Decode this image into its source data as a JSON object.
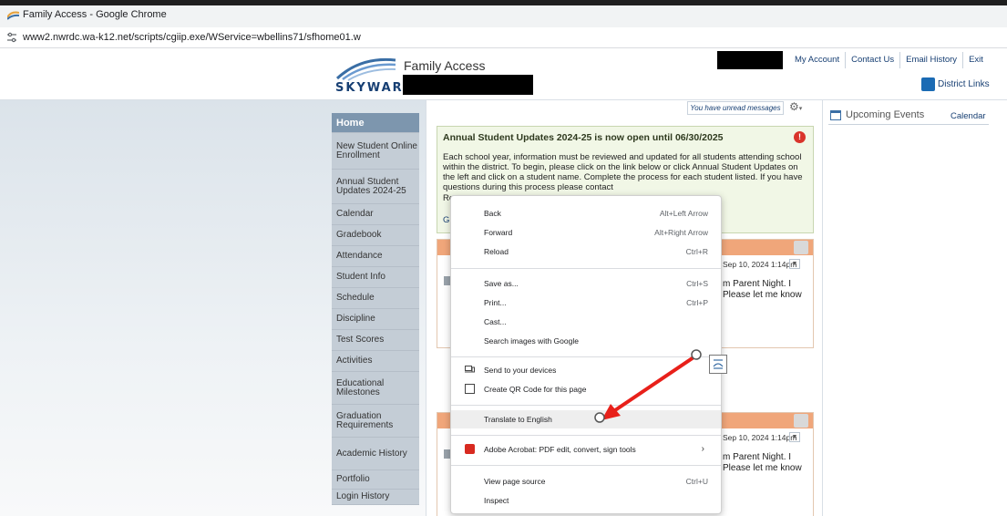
{
  "browser": {
    "window_title": "Family Access - Google Chrome",
    "url": "www2.nwrdc.wa-k12.net/scripts/cgiip.exe/WService=wbellins71/sfhome01.w"
  },
  "header": {
    "logo_text": "SKYWARD",
    "app_name": "Family Access",
    "top_links": [
      "My Account",
      "Contact Us",
      "Email History",
      "Exit"
    ],
    "district_links": "District Links"
  },
  "sidebar": {
    "items": [
      {
        "label": "Home"
      },
      {
        "label": "New Student Online Enrollment"
      },
      {
        "label": "Annual Student Updates 2024-25"
      },
      {
        "label": "Calendar"
      },
      {
        "label": "Gradebook"
      },
      {
        "label": "Attendance"
      },
      {
        "label": "Student Info"
      },
      {
        "label": "Schedule"
      },
      {
        "label": "Discipline"
      },
      {
        "label": "Test Scores"
      },
      {
        "label": "Activities"
      },
      {
        "label": "Educational Milestones"
      },
      {
        "label": "Graduation Requirements"
      },
      {
        "label": "Academic History"
      },
      {
        "label": "Portfolio"
      },
      {
        "label": "Login History"
      }
    ]
  },
  "main": {
    "unread_messages": "You have unread messages",
    "announcement": {
      "title": "Annual Student Updates 2024-25 is now open until 06/30/2025",
      "body": "Each school year, information must be reviewed and updated for all students attending school within the district. To begin, please click on the link below or click Annual Student Updates on the left and click on a student name. Complete the process for each student listed. If you have questions during this process please contact",
      "line_r": "Re",
      "line_g": "G"
    },
    "messages": [
      {
        "date": "Sep 10, 2024 1:14pm",
        "line1": "m Parent Night. I",
        "line2": "Please let me know"
      },
      {
        "date": "Sep 10, 2024 1:14pm",
        "line1": "m Parent Night. I",
        "line2": "Please let me know"
      }
    ]
  },
  "right_panel": {
    "upcoming_events": "Upcoming Events",
    "calendar_link": "Calendar"
  },
  "context_menu": {
    "back": {
      "label": "Back",
      "shortcut": "Alt+Left Arrow"
    },
    "forward": {
      "label": "Forward",
      "shortcut": "Alt+Right Arrow"
    },
    "reload": {
      "label": "Reload",
      "shortcut": "Ctrl+R"
    },
    "save_as": {
      "label": "Save as...",
      "shortcut": "Ctrl+S"
    },
    "print": {
      "label": "Print...",
      "shortcut": "Ctrl+P"
    },
    "cast": {
      "label": "Cast..."
    },
    "search_images": {
      "label": "Search images with Google"
    },
    "send_devices": {
      "label": "Send to your devices"
    },
    "qr_code": {
      "label": "Create QR Code for this page"
    },
    "translate": {
      "label": "Translate to English"
    },
    "adobe": {
      "label": "Adobe Acrobat: PDF edit, convert, sign tools"
    },
    "view_source": {
      "label": "View page source",
      "shortcut": "Ctrl+U"
    },
    "inspect": {
      "label": "Inspect"
    }
  },
  "colors": {
    "arrow": "#e8201a",
    "sidebar_active": "#7d96ae",
    "brand_blue": "#173f73"
  }
}
